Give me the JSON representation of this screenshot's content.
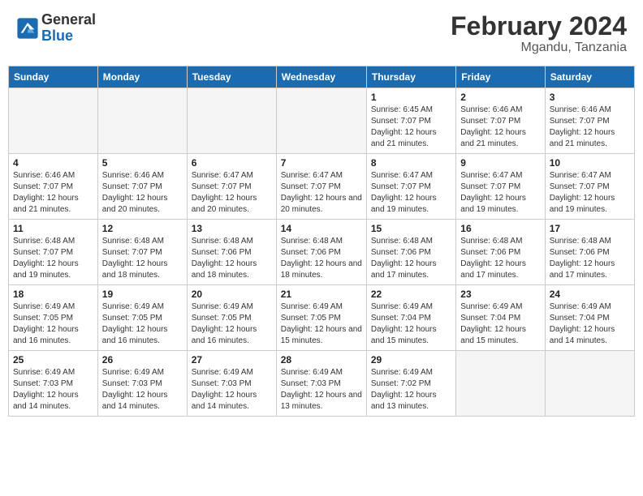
{
  "logo": {
    "general": "General",
    "blue": "Blue"
  },
  "header": {
    "month": "February 2024",
    "location": "Mgandu, Tanzania"
  },
  "weekdays": [
    "Sunday",
    "Monday",
    "Tuesday",
    "Wednesday",
    "Thursday",
    "Friday",
    "Saturday"
  ],
  "weeks": [
    [
      {
        "day": "",
        "sunrise": "",
        "sunset": "",
        "daylight": "",
        "empty": true
      },
      {
        "day": "",
        "sunrise": "",
        "sunset": "",
        "daylight": "",
        "empty": true
      },
      {
        "day": "",
        "sunrise": "",
        "sunset": "",
        "daylight": "",
        "empty": true
      },
      {
        "day": "",
        "sunrise": "",
        "sunset": "",
        "daylight": "",
        "empty": true
      },
      {
        "day": "1",
        "sunrise": "Sunrise: 6:45 AM",
        "sunset": "Sunset: 7:07 PM",
        "daylight": "Daylight: 12 hours and 21 minutes.",
        "empty": false
      },
      {
        "day": "2",
        "sunrise": "Sunrise: 6:46 AM",
        "sunset": "Sunset: 7:07 PM",
        "daylight": "Daylight: 12 hours and 21 minutes.",
        "empty": false
      },
      {
        "day": "3",
        "sunrise": "Sunrise: 6:46 AM",
        "sunset": "Sunset: 7:07 PM",
        "daylight": "Daylight: 12 hours and 21 minutes.",
        "empty": false
      }
    ],
    [
      {
        "day": "4",
        "sunrise": "Sunrise: 6:46 AM",
        "sunset": "Sunset: 7:07 PM",
        "daylight": "Daylight: 12 hours and 21 minutes.",
        "empty": false
      },
      {
        "day": "5",
        "sunrise": "Sunrise: 6:46 AM",
        "sunset": "Sunset: 7:07 PM",
        "daylight": "Daylight: 12 hours and 20 minutes.",
        "empty": false
      },
      {
        "day": "6",
        "sunrise": "Sunrise: 6:47 AM",
        "sunset": "Sunset: 7:07 PM",
        "daylight": "Daylight: 12 hours and 20 minutes.",
        "empty": false
      },
      {
        "day": "7",
        "sunrise": "Sunrise: 6:47 AM",
        "sunset": "Sunset: 7:07 PM",
        "daylight": "Daylight: 12 hours and 20 minutes.",
        "empty": false
      },
      {
        "day": "8",
        "sunrise": "Sunrise: 6:47 AM",
        "sunset": "Sunset: 7:07 PM",
        "daylight": "Daylight: 12 hours and 19 minutes.",
        "empty": false
      },
      {
        "day": "9",
        "sunrise": "Sunrise: 6:47 AM",
        "sunset": "Sunset: 7:07 PM",
        "daylight": "Daylight: 12 hours and 19 minutes.",
        "empty": false
      },
      {
        "day": "10",
        "sunrise": "Sunrise: 6:47 AM",
        "sunset": "Sunset: 7:07 PM",
        "daylight": "Daylight: 12 hours and 19 minutes.",
        "empty": false
      }
    ],
    [
      {
        "day": "11",
        "sunrise": "Sunrise: 6:48 AM",
        "sunset": "Sunset: 7:07 PM",
        "daylight": "Daylight: 12 hours and 19 minutes.",
        "empty": false
      },
      {
        "day": "12",
        "sunrise": "Sunrise: 6:48 AM",
        "sunset": "Sunset: 7:07 PM",
        "daylight": "Daylight: 12 hours and 18 minutes.",
        "empty": false
      },
      {
        "day": "13",
        "sunrise": "Sunrise: 6:48 AM",
        "sunset": "Sunset: 7:06 PM",
        "daylight": "Daylight: 12 hours and 18 minutes.",
        "empty": false
      },
      {
        "day": "14",
        "sunrise": "Sunrise: 6:48 AM",
        "sunset": "Sunset: 7:06 PM",
        "daylight": "Daylight: 12 hours and 18 minutes.",
        "empty": false
      },
      {
        "day": "15",
        "sunrise": "Sunrise: 6:48 AM",
        "sunset": "Sunset: 7:06 PM",
        "daylight": "Daylight: 12 hours and 17 minutes.",
        "empty": false
      },
      {
        "day": "16",
        "sunrise": "Sunrise: 6:48 AM",
        "sunset": "Sunset: 7:06 PM",
        "daylight": "Daylight: 12 hours and 17 minutes.",
        "empty": false
      },
      {
        "day": "17",
        "sunrise": "Sunrise: 6:48 AM",
        "sunset": "Sunset: 7:06 PM",
        "daylight": "Daylight: 12 hours and 17 minutes.",
        "empty": false
      }
    ],
    [
      {
        "day": "18",
        "sunrise": "Sunrise: 6:49 AM",
        "sunset": "Sunset: 7:05 PM",
        "daylight": "Daylight: 12 hours and 16 minutes.",
        "empty": false
      },
      {
        "day": "19",
        "sunrise": "Sunrise: 6:49 AM",
        "sunset": "Sunset: 7:05 PM",
        "daylight": "Daylight: 12 hours and 16 minutes.",
        "empty": false
      },
      {
        "day": "20",
        "sunrise": "Sunrise: 6:49 AM",
        "sunset": "Sunset: 7:05 PM",
        "daylight": "Daylight: 12 hours and 16 minutes.",
        "empty": false
      },
      {
        "day": "21",
        "sunrise": "Sunrise: 6:49 AM",
        "sunset": "Sunset: 7:05 PM",
        "daylight": "Daylight: 12 hours and 15 minutes.",
        "empty": false
      },
      {
        "day": "22",
        "sunrise": "Sunrise: 6:49 AM",
        "sunset": "Sunset: 7:04 PM",
        "daylight": "Daylight: 12 hours and 15 minutes.",
        "empty": false
      },
      {
        "day": "23",
        "sunrise": "Sunrise: 6:49 AM",
        "sunset": "Sunset: 7:04 PM",
        "daylight": "Daylight: 12 hours and 15 minutes.",
        "empty": false
      },
      {
        "day": "24",
        "sunrise": "Sunrise: 6:49 AM",
        "sunset": "Sunset: 7:04 PM",
        "daylight": "Daylight: 12 hours and 14 minutes.",
        "empty": false
      }
    ],
    [
      {
        "day": "25",
        "sunrise": "Sunrise: 6:49 AM",
        "sunset": "Sunset: 7:03 PM",
        "daylight": "Daylight: 12 hours and 14 minutes.",
        "empty": false
      },
      {
        "day": "26",
        "sunrise": "Sunrise: 6:49 AM",
        "sunset": "Sunset: 7:03 PM",
        "daylight": "Daylight: 12 hours and 14 minutes.",
        "empty": false
      },
      {
        "day": "27",
        "sunrise": "Sunrise: 6:49 AM",
        "sunset": "Sunset: 7:03 PM",
        "daylight": "Daylight: 12 hours and 14 minutes.",
        "empty": false
      },
      {
        "day": "28",
        "sunrise": "Sunrise: 6:49 AM",
        "sunset": "Sunset: 7:03 PM",
        "daylight": "Daylight: 12 hours and 13 minutes.",
        "empty": false
      },
      {
        "day": "29",
        "sunrise": "Sunrise: 6:49 AM",
        "sunset": "Sunset: 7:02 PM",
        "daylight": "Daylight: 12 hours and 13 minutes.",
        "empty": false
      },
      {
        "day": "",
        "sunrise": "",
        "sunset": "",
        "daylight": "",
        "empty": true
      },
      {
        "day": "",
        "sunrise": "",
        "sunset": "",
        "daylight": "",
        "empty": true
      }
    ]
  ]
}
